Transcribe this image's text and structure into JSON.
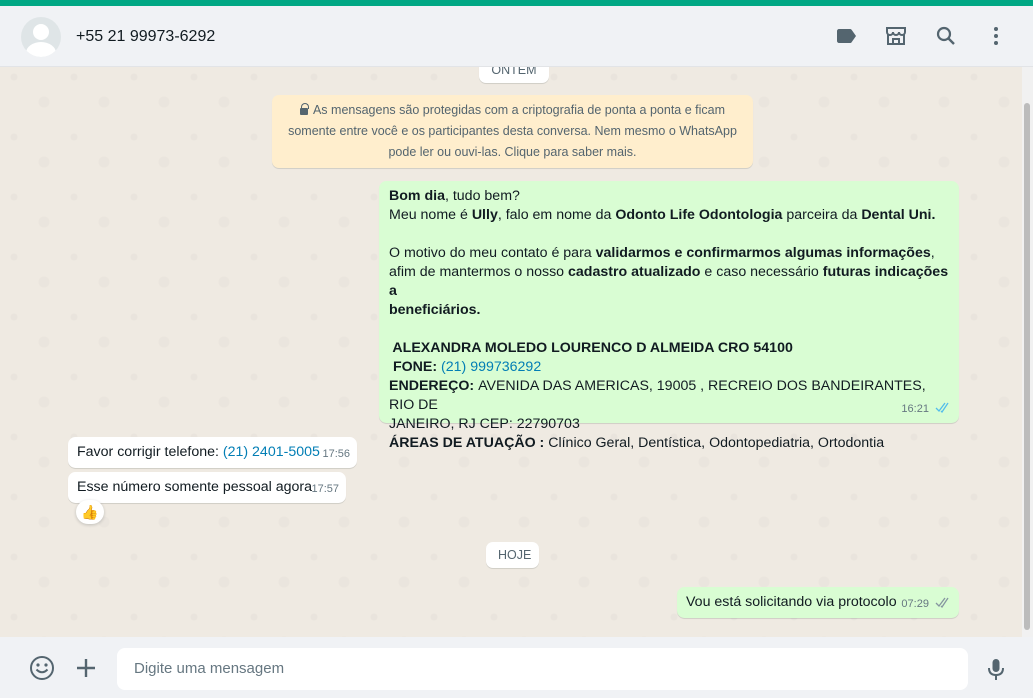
{
  "header": {
    "contact_name": "+55 21 99973-6292",
    "icons": [
      "label-icon",
      "shop-icon",
      "search-icon",
      "menu-icon"
    ]
  },
  "chat": {
    "date_pill_top": "ONTEM",
    "encryption_notice": {
      "line1": "As mensagens são protegidas com a criptografia de ponta a ponta e ficam",
      "line2": "somente entre você e os participantes desta conversa. Nem mesmo o WhatsApp",
      "line3": "pode ler ou ouvi-las. Clique para saber mais."
    },
    "message_long": {
      "l1_bold": "Bom dia",
      "l1_rest": ", tudo bem?",
      "l2_a": "Meu nome é ",
      "l2_b": "Ully",
      "l2_c": ", falo em nome da ",
      "l2_d": "Odonto Life Odontologia",
      "l2_e": " parceira da ",
      "l2_f": "Dental Uni.",
      "l4_a": "O motivo do meu contato é para ",
      "l4_b": "validarmos e confirmarmos algumas informações",
      "l4_c": ",",
      "l5_a": "afim de mantermos o nosso ",
      "l5_b": "cadastro atualizado",
      "l5_c": " e caso necessário ",
      "l5_d": "futuras indicações a",
      "l6": "beneficiários.",
      "l8": " ALEXANDRA MOLEDO LOURENCO D ALMEIDA CRO 54100",
      "l9_label": " FONE: ",
      "l9_phone": "(21) 999736292",
      "l10_label": "ENDEREÇO: ",
      "l10_text": "AVENIDA DAS AMERICAS, 19005 , RECREIO DOS BANDEIRANTES, RIO DE",
      "l11": "JANEIRO, RJ CEP: 22790703",
      "l12_label": "ÁREAS DE ATUAÇÃO : ",
      "l12_text": "Clínico Geral, Dentística, Odontopediatria, Ortodontia",
      "time": "16:21"
    },
    "message_in_1": {
      "text": "Favor corrigir telefone: ",
      "phone": "(21) 2401-5005",
      "time": "17:56"
    },
    "message_in_2": {
      "text": "Esse número somente pessoal agora",
      "time": "17:57",
      "reaction": "👍"
    },
    "date_pill_today": "HOJE",
    "message_out_last": {
      "text": "Vou está solicitando via protocolo",
      "time": "07:29"
    }
  },
  "composer": {
    "placeholder": "Digite uma mensagem",
    "icons": [
      "emoji-icon",
      "attach-icon",
      "microphone-icon"
    ]
  },
  "colors": {
    "accent": "#00a884",
    "outgoing_bubble": "#d9fdd3",
    "incoming_bubble": "#ffffff",
    "read_tick": "#53bdeb",
    "encryption_bg": "#ffeecd"
  }
}
